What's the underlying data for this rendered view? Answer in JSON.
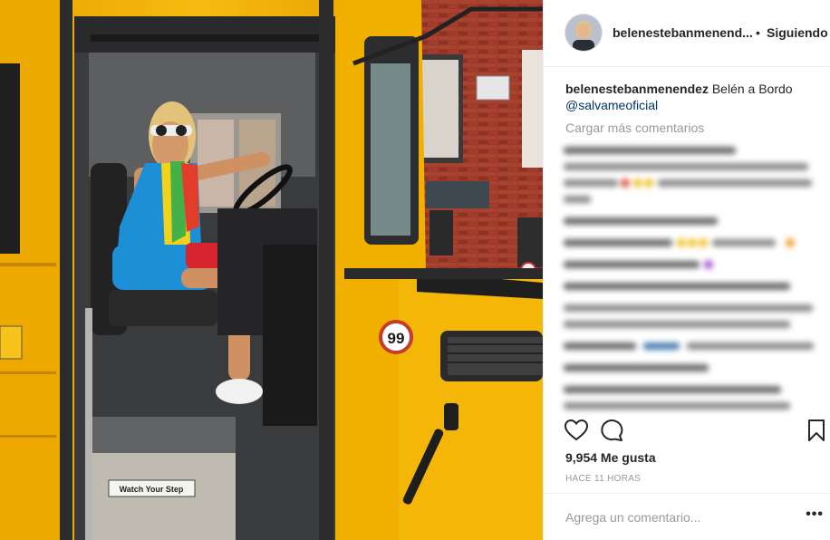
{
  "post": {
    "username": "belenestebanmenend...",
    "follow_separator": "•",
    "follow_status": "Siguiendo",
    "caption_user": "belenestebanmenendez",
    "caption_text": "Belén a Bordo",
    "caption_mention": "@salvameoficial",
    "load_more": "Cargar más comentarios",
    "likes": "9,954 Me gusta",
    "time": "HACE 11 HORAS",
    "comment_placeholder": "Agrega un comentario...",
    "more_options": "•••"
  },
  "photo": {
    "bus_number": "99",
    "step_sign": "Watch Your Step"
  },
  "colors": {
    "bus_yellow": "#f2b300",
    "text_dark": "#262626",
    "text_muted": "#999999",
    "mention": "#003569",
    "divider": "#efefef"
  },
  "icons": [
    "heart-icon",
    "comment-icon",
    "bookmark-icon",
    "more-options-icon"
  ]
}
